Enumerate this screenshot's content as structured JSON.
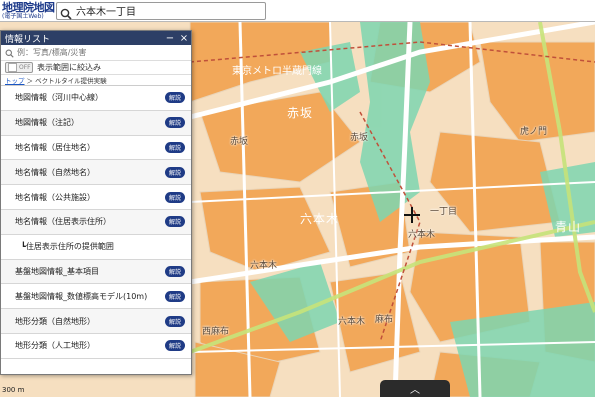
{
  "topbar": {
    "logo_line1": "地理院地図",
    "logo_line2": "(電子国土Web)",
    "search_value": "六本木一丁目"
  },
  "panel": {
    "title": "情報リスト",
    "header_buttons": [
      "−",
      "×"
    ],
    "search_placeholder": "例：写真/標高/災害",
    "toggle_label": "OFF",
    "filter_label": "表示範囲に絞込み",
    "breadcrumb_top": "トップ",
    "breadcrumb_rest": "＞ ベクトルタイル提供実験",
    "items": [
      {
        "label": "地図情報（河川中心線）",
        "badge": "解説"
      },
      {
        "label": "地図情報（注記）",
        "badge": "解説"
      },
      {
        "label": "地名情報（居住地名）",
        "badge": "解説"
      },
      {
        "label": "地名情報（自然地名）",
        "badge": "解説"
      },
      {
        "label": "地名情報（公共施設）",
        "badge": "解説"
      },
      {
        "label": "地名情報（住居表示住所）",
        "badge": "解説"
      },
      {
        "label": "┗住居表示住所の提供範囲",
        "badge": ""
      },
      {
        "label": "基盤地図情報_基本項目",
        "badge": "解説"
      },
      {
        "label": "基盤地図情報_数値標高モデル(10m)",
        "badge": "解説"
      },
      {
        "label": "地形分類（自然地形）",
        "badge": "解説"
      },
      {
        "label": "地形分類（人工地形）",
        "badge": "解説"
      }
    ]
  },
  "map": {
    "labels": {
      "l1": "東京メトロ半蔵門線",
      "l2": "赤坂",
      "l3": "赤坂",
      "l4": "六本木",
      "l5": "六本木",
      "l6": "六本木",
      "l7": "麻布",
      "l8": "西麻布",
      "l9": "青山",
      "l10": "虎ノ門",
      "l11": "一丁目",
      "l12": "赤坂",
      "l13": "六本木"
    },
    "scale": "300 m"
  },
  "colors": {
    "map_orange": "#f2a85a",
    "map_light": "#f6dfc0",
    "map_green": "#7ed6b0",
    "map_road": "#ffffff",
    "panel_header": "#2d3f66",
    "badge": "#1f3b86"
  },
  "bottom_tab": "︿"
}
